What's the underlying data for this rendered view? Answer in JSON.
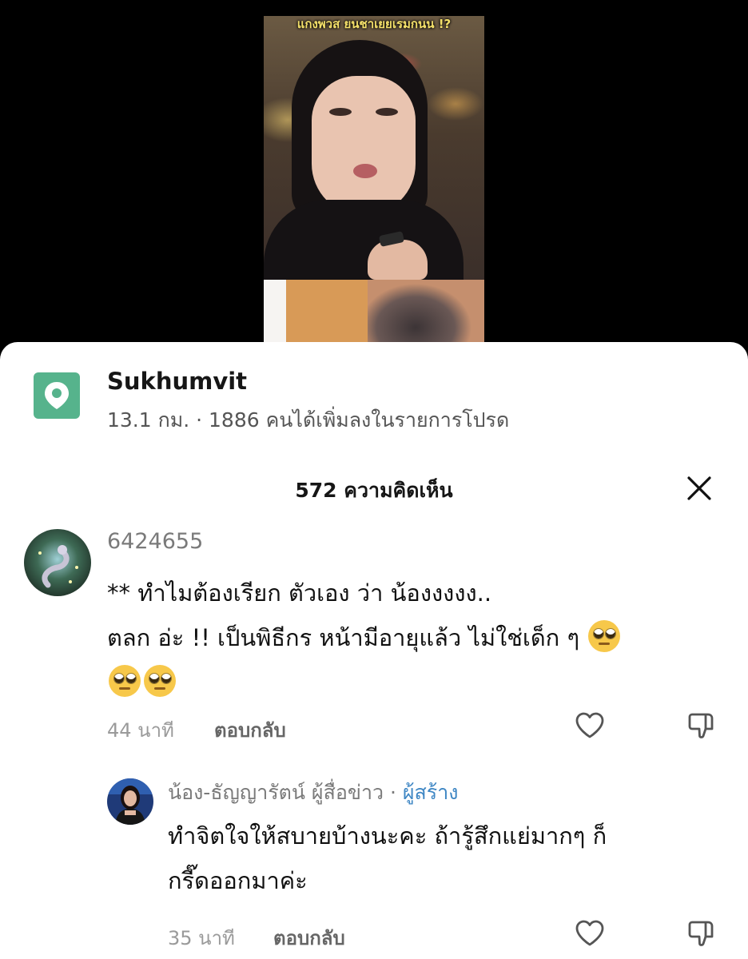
{
  "video": {
    "caption": "แกงพวส ยนชาเยยเรมกนน !?"
  },
  "location": {
    "title": "Sukhumvit",
    "subtitle": "13.1 กม. · 1886 คนได้เพิ่มลงในรายการโปรด",
    "icon": "map-pin-icon",
    "accent": "#56b38c"
  },
  "comments_header": {
    "title": "572 ความคิดเห็น"
  },
  "comments": [
    {
      "username": "6424655",
      "line1": "** ทำไมต้องเรียก ตัวเอง ว่า น้องงงงง..",
      "line2": "ตลก อ่ะ !! เป็นพิธีกร หน้ามีอายุแล้ว ไม่ใช่เด็ก ๆ",
      "emoji": "face-with-rolling-eyes",
      "time": "44 นาที",
      "reply": "ตอบกลับ"
    },
    {
      "username": "น้อง-ธัญญารัตน์ ผู้สื่อข่าว",
      "separator": "·",
      "badge": "ผู้สร้าง",
      "line1": "ทำจิตใจให้สบายบ้างนะคะ ถ้ารู้สึกแย่มากๆ ก็",
      "line2": "กรี๊ดออกมาค่ะ",
      "time": "35 นาที",
      "reply": "ตอบกลับ"
    }
  ],
  "colors": {
    "creator_badge": "#3f87c4",
    "sheet_bg": "#ffffff"
  }
}
